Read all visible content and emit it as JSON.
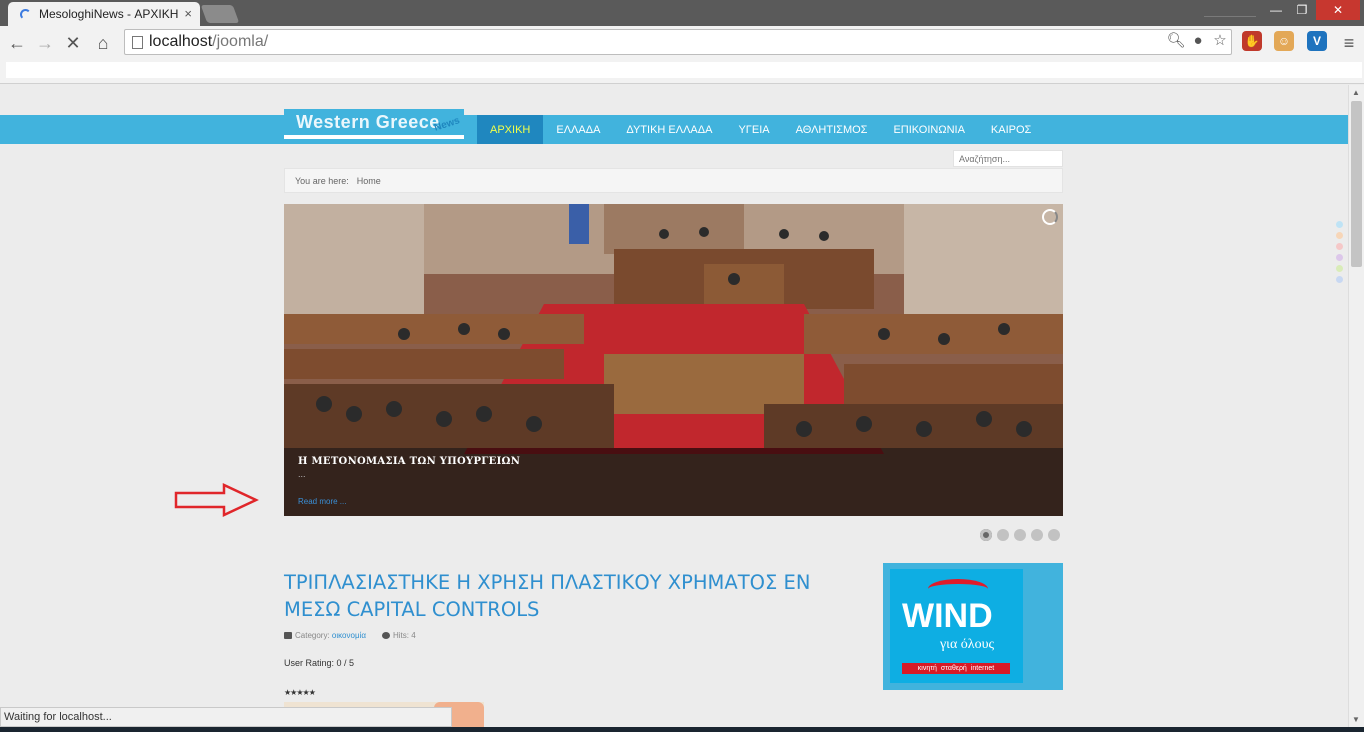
{
  "browser": {
    "tab_title": "MesologhiNews - ΑΡΧΙΚΗ",
    "tab_close": "×",
    "window_controls": {
      "minimize": "—",
      "maximize": "❐",
      "close": "✕"
    },
    "url_host": "localhost",
    "url_path": "/joomla/",
    "nav": {
      "back": "←",
      "forward": "→",
      "stop": "✕",
      "home": "⌂"
    },
    "omnibox_icons": [
      "search-icon",
      "lightbulb-icon",
      "star-icon"
    ],
    "extensions": [
      {
        "name": "adblock-extension",
        "glyph": "✋",
        "color": "#c0392b"
      },
      {
        "name": "persona-extension",
        "glyph": "☺",
        "color": "#e3a857"
      },
      {
        "name": "v-extension",
        "glyph": "V",
        "color": "#1e73be"
      }
    ],
    "menu_glyph": "≡",
    "status_text": "Waiting for localhost..."
  },
  "site": {
    "logo_text": "Western Greece",
    "logo_sub": "News",
    "menu": [
      {
        "label": "ΑΡΧΙΚΗ",
        "active": true
      },
      {
        "label": "ΕΛΛΑΔΑ"
      },
      {
        "label": "ΔΥΤΙΚΗ ΕΛΛΑΔΑ"
      },
      {
        "label": "ΥΓΕΙΑ"
      },
      {
        "label": "ΑΘΛΗΤΙΣΜΟΣ"
      },
      {
        "label": "ΕΠΙΚΟΙΝΩΝΙΑ"
      },
      {
        "label": "ΚΑΙΡΟΣ"
      }
    ],
    "search_placeholder": "Αναζήτηση...",
    "breadcrumb": {
      "prefix": "You are here:",
      "current": "Home"
    },
    "slider": {
      "caption_title": "Η ΜΕΤΟΝΟΜΑΣΙΑ ΤΩΝ ΥΠΟΥΡΓΕΙΩΝ",
      "caption_text": "...",
      "read_more": "Read more ...",
      "slide_count": 5,
      "active_slide": 1
    },
    "article": {
      "title": "ΤΡΙΠΛΑΣΙΑΣΤΗΚΕ Η ΧΡΗΣΗ ΠΛΑΣΤΙΚΟΥ ΧΡΗΜΑΤΟΣ ΕΝ ΜΕΣΩ CAPITAL CONTROLS",
      "category_label": "Category:",
      "category": "οικονομία",
      "hits": "Hits: 4",
      "rating": "User Rating:  0 / 5",
      "stars": "★★★★★"
    },
    "ad": {
      "brand": "WIND",
      "tagline": "για όλους",
      "strip": [
        "κινητή",
        "σταθερή",
        "internet"
      ]
    },
    "side_dot_colors": [
      "#bfe3f5",
      "#f7d6b8",
      "#f5c8c8",
      "#dcc7ea",
      "#d9ecb8",
      "#c8d8f2"
    ]
  },
  "annotation": {
    "arrow_color": "#e0262a"
  }
}
